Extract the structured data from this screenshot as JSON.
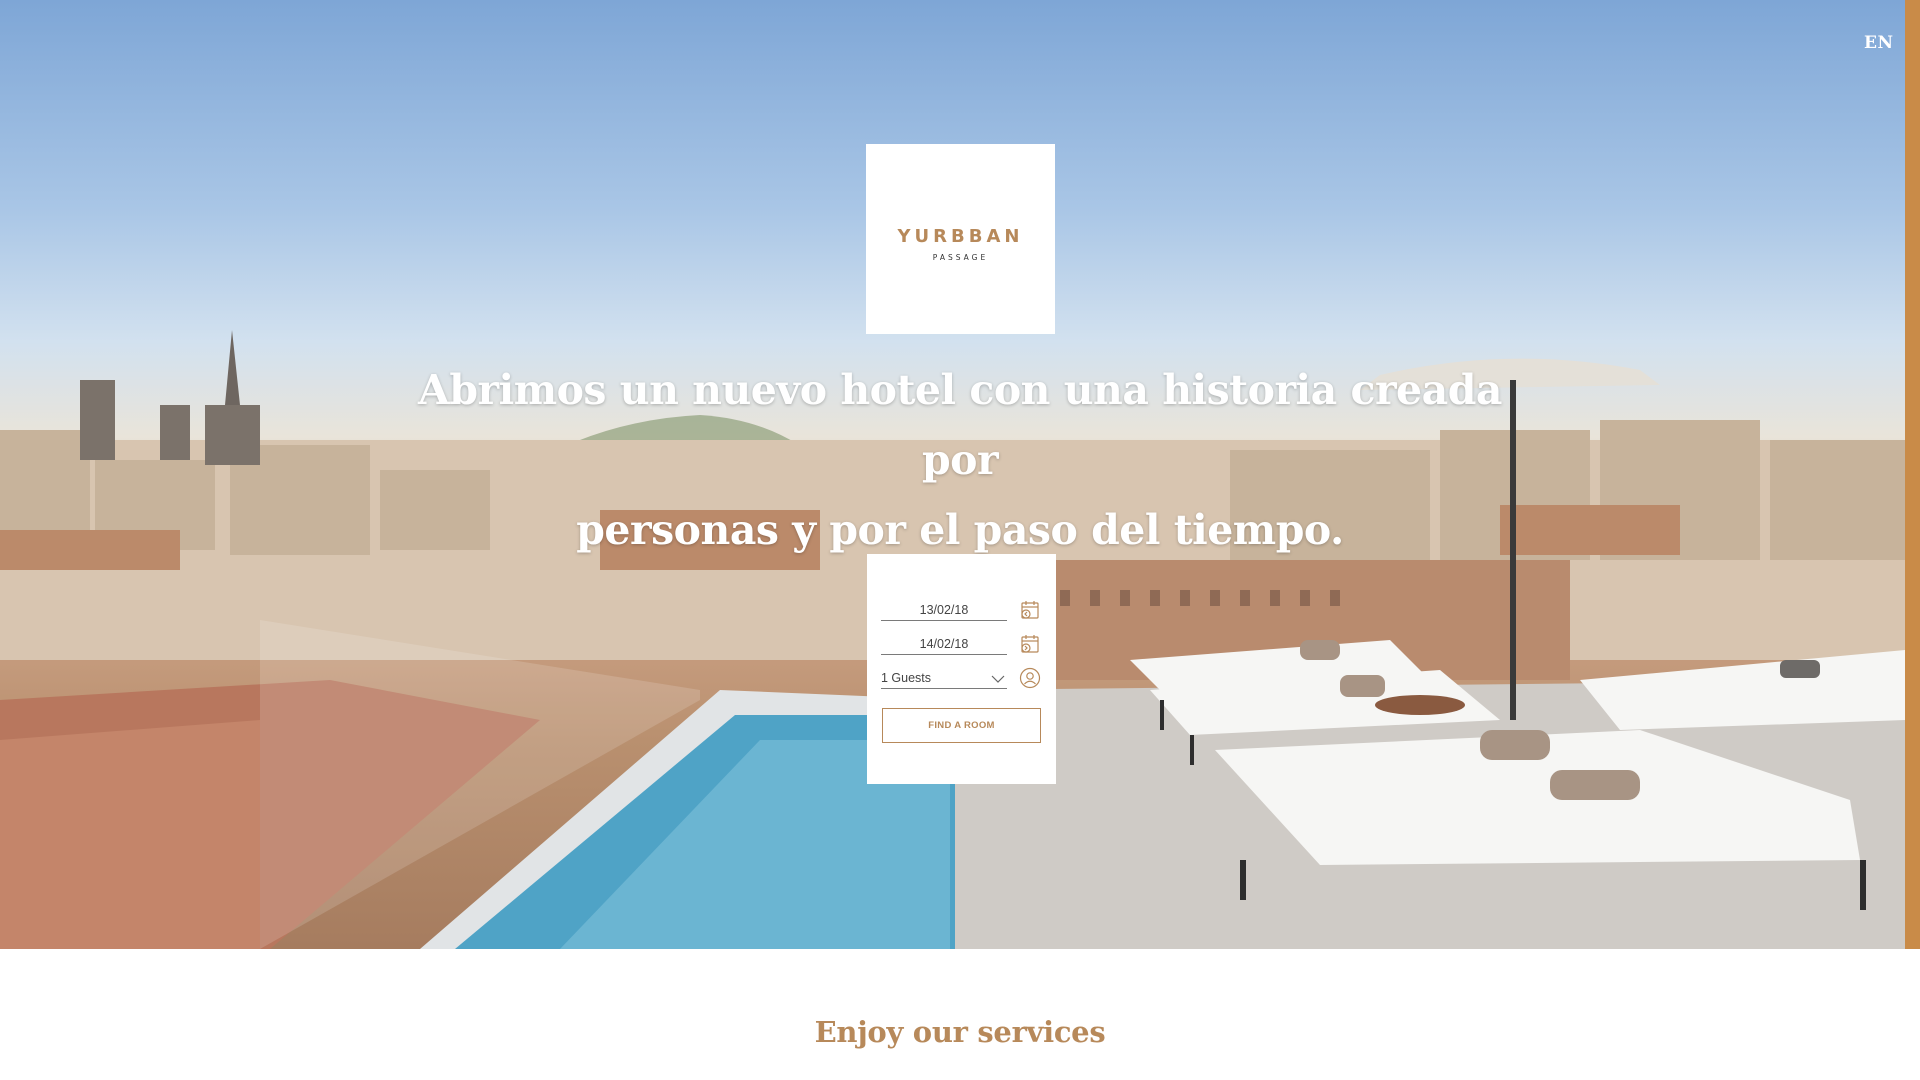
{
  "nav": {
    "language": "EN"
  },
  "logo": {
    "name": "YURBBAN",
    "subtitle": "PASSAGE"
  },
  "hero": {
    "headline_line1": "Abrimos un nuevo hotel con una historia creada por",
    "headline_line2": "personas y por el paso del tiempo."
  },
  "booking": {
    "checkin": "13/02/18",
    "checkout": "14/02/18",
    "guests": "1 Guests",
    "guests_options": [
      "1 Guests"
    ],
    "find_button": "FIND A ROOM",
    "icons": [
      "calendar-checkin-icon",
      "calendar-checkout-icon",
      "chevron-down-icon",
      "person-icon"
    ]
  },
  "services": {
    "title": "Enjoy our services"
  },
  "colors": {
    "accent": "#b7895a",
    "white": "#ffffff",
    "text": "#444444"
  }
}
